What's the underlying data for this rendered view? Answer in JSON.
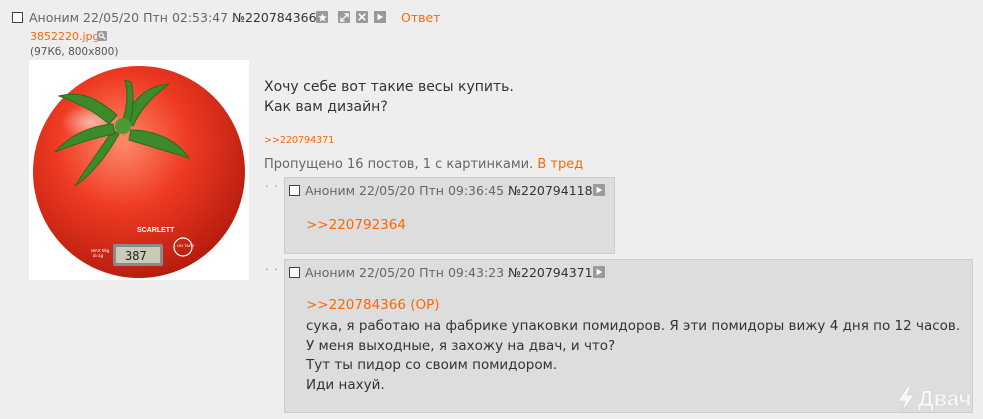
{
  "op": {
    "author": "Аноним",
    "datetime": "22/05/20 Птн 02:53:47",
    "number": "№220784366",
    "reply_label": "Ответ",
    "file_name": "3852220.jpg",
    "file_info": "(97Кб, 800x800)",
    "image_text": {
      "brand": "SCARLETT",
      "max": "MAX 5kg",
      "d": "d=1g",
      "display": "387",
      "on_tare": "ON TARE"
    },
    "body_lines": [
      "Хочу себе вот такие весы купить.",
      "Как вам дизайн?"
    ],
    "backlink": ">>220794371",
    "omitted": "Пропущено 16 постов, 1 с картинками.",
    "to_thread": "В тред"
  },
  "replies": [
    {
      "dots": "· · ·",
      "author": "Аноним",
      "datetime": "22/05/20 Птн 09:36:45",
      "number": "№220794118",
      "quote": ">>220792364",
      "lines": []
    },
    {
      "dots": "· · ·",
      "author": "Аноним",
      "datetime": "22/05/20 Птн 09:43:23",
      "number": "№220794371",
      "quote": ">>220784366 (OP)",
      "lines": [
        "сука, я работаю на фабрике упаковки помидоров. Я эти помидоры вижу 4 дня по 12 часов.",
        "У меня выходные, я захожу на двач, и что?",
        "Тут ты пидор со своим помидором.",
        "Иди нахуй."
      ]
    }
  ],
  "watermark": "Двач",
  "colors": {
    "accent": "#ff6600",
    "background": "#eeeeee",
    "reply_bg": "#dddddd"
  }
}
